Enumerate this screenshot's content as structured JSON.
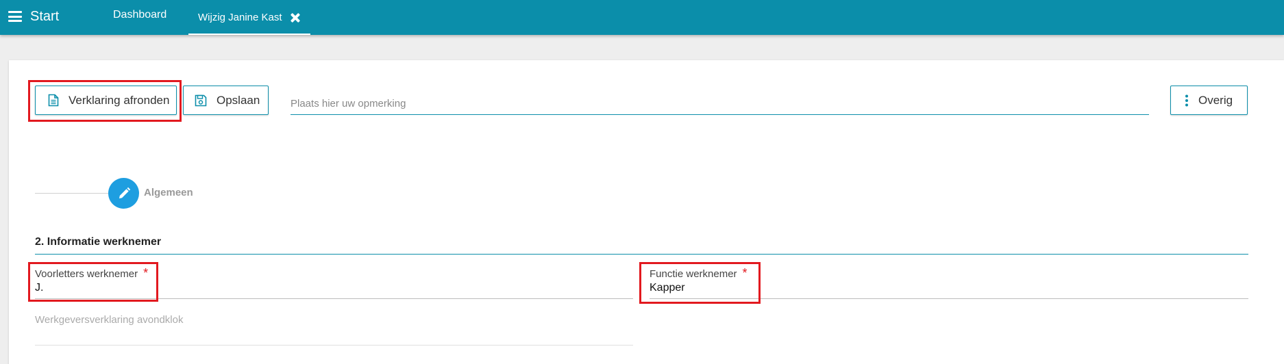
{
  "topbar": {
    "start_label": "Start",
    "tabs": [
      {
        "label": "Dashboard"
      },
      {
        "label": "Wijzig Janine Kast"
      }
    ]
  },
  "toolbar": {
    "afronden_label": "Verklaring afronden",
    "opslaan_label": "Opslaan",
    "remark_placeholder": "Plaats hier uw opmerking",
    "overig_label": "Overig"
  },
  "stepper": {
    "step_label": "Algemeen"
  },
  "section": {
    "title": "2. Informatie werknemer"
  },
  "fields": {
    "voorletters": {
      "label": "Voorletters werknemer",
      "required_mark": "*",
      "value": "J."
    },
    "functie": {
      "label": "Functie werknemer",
      "required_mark": "*",
      "value": "Kapper"
    },
    "avondklok": {
      "label": "Werkgeversverklaring avondklok"
    }
  },
  "colors": {
    "brand": "#0b8eaa",
    "step": "#1e9ee0",
    "highlight": "#e2191f"
  }
}
